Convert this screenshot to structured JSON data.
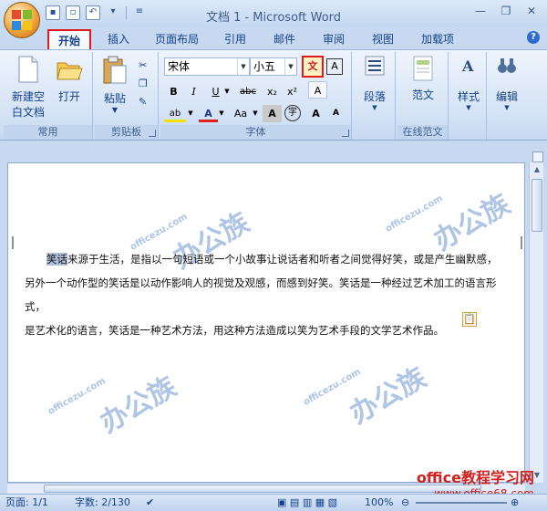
{
  "window": {
    "title": "文档 1 - Microsoft Word"
  },
  "tabs": [
    "开始",
    "插入",
    "页面布局",
    "引用",
    "邮件",
    "审阅",
    "视图",
    "加载项"
  ],
  "groups": {
    "common": {
      "label": "常用",
      "new_label_line1": "新建空",
      "new_label_line2": "白文档",
      "open_label": "打开"
    },
    "clipboard": {
      "label": "剪贴板",
      "paste_label": "粘贴"
    },
    "font": {
      "label": "字体",
      "font_name": "宋体",
      "font_size": "小五",
      "bold": "B",
      "italic": "I",
      "underline": "U",
      "strikethrough": "abc",
      "subscript": "x₂",
      "superscript": "x²",
      "phonetic_guide": "文",
      "char_border": "A",
      "char_shading": "A",
      "enclose_char": "字",
      "grow_font": "A",
      "shrink_font": "A",
      "change_case": "Aa",
      "font_color": "A",
      "highlight": "ab",
      "clear_format": "A"
    },
    "paragraph": {
      "label": "段落"
    },
    "template": {
      "label": "在线范文",
      "button_label": "范文"
    },
    "styles": {
      "label": "样式"
    },
    "editing": {
      "label": "编辑"
    }
  },
  "document": {
    "highlighted_word": "笑话",
    "line1_rest": "来源于生活，是指以一句短语或一个小故事让说话者和听者之间觉得好笑，或是产生幽默感，",
    "line2": "另外一个动作型的笑话是以动作影响人的视觉及观感，而感到好笑。笑话是一种经过艺术加工的语言形式，",
    "line3": "是艺术化的语言，笑话是一种艺术方法，用这种方法造成以笑为艺术手段的文学艺术作品。"
  },
  "watermark": {
    "text": "办公族",
    "site": "officezu.com"
  },
  "status": {
    "page": "页面: 1/1",
    "words": "字数: 2/130",
    "zoom": "100%"
  },
  "brand": {
    "line1": "office教程学习网",
    "line2": "www.office68.com"
  }
}
